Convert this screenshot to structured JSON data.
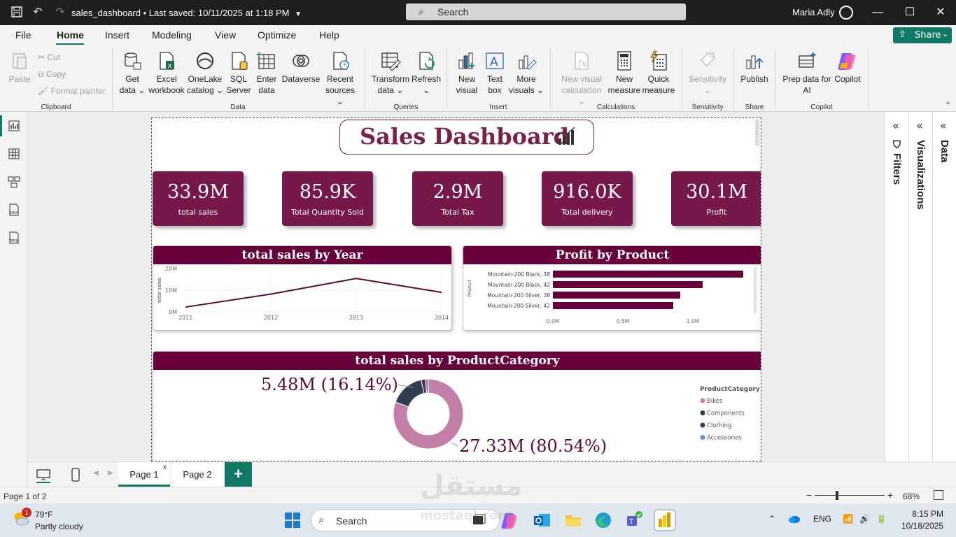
{
  "window": {
    "doc_title": "sales_dashboard • Last saved: 10/11/2025 at 1:18 PM",
    "search_label": "Search",
    "user_name": "Maria Adly"
  },
  "menu": {
    "items": [
      "File",
      "Home",
      "Insert",
      "Modeling",
      "View",
      "Optimize",
      "Help"
    ],
    "active": "Home",
    "share_label": "Share"
  },
  "ribbon": {
    "clipboard": {
      "paste": "Paste",
      "cut": "Cut",
      "copy": "Copy",
      "format_painter": "Format painter",
      "group": "Clipboard"
    },
    "data": {
      "get_data": [
        "Get",
        "data ⌄"
      ],
      "excel": [
        "Excel",
        "workbook"
      ],
      "onelake": [
        "OneLake",
        "catalog ⌄"
      ],
      "sql": [
        "SQL",
        "Server"
      ],
      "enter": [
        "Enter",
        "data"
      ],
      "dataverse": [
        "Dataverse",
        ""
      ],
      "recent": [
        "Recent",
        "sources ⌄"
      ],
      "group": "Data"
    },
    "queries": {
      "transform": [
        "Transform",
        "data ⌄"
      ],
      "refresh": [
        "Refresh",
        "⌄"
      ],
      "group": "Queries"
    },
    "insert": {
      "new_visual": [
        "New",
        "visual"
      ],
      "text_box": [
        "Text",
        "box"
      ],
      "more_visuals": [
        "More",
        "visuals ⌄"
      ],
      "group": "Insert"
    },
    "calculations": {
      "new_visual_calc": [
        "New visual",
        "calculation ⌄"
      ],
      "new_measure": [
        "New",
        "measure"
      ],
      "quick_measure": [
        "Quick",
        "measure"
      ],
      "group": "Calculations"
    },
    "sensitivity": {
      "label": [
        "Sensitivity",
        "⌄"
      ],
      "group": "Sensitivity"
    },
    "share": {
      "publish": [
        "Publish",
        ""
      ],
      "group": "Share"
    },
    "copilot": {
      "prep": [
        "Prep data for",
        "AI"
      ],
      "copilot": [
        "Copilot",
        ""
      ],
      "group": "Copilot"
    }
  },
  "report": {
    "title": "Sales Dashboard",
    "kpis": [
      {
        "value": "33.9M",
        "label": "total sales"
      },
      {
        "value": "85.9K",
        "label": "Total Quantity Sold"
      },
      {
        "value": "2.9M",
        "label": "Total Tax"
      },
      {
        "value": "916.0K",
        "label": "Total delivery"
      },
      {
        "value": "30.1M",
        "label": "Profit"
      }
    ],
    "colors": {
      "primary": "#76184a",
      "header": "#68003a",
      "line": "#5c0a33"
    }
  },
  "chart_data": [
    {
      "type": "line",
      "title": "total sales by Year",
      "xlabel": "",
      "ylabel": "total sales",
      "x": [
        "2011",
        "2012",
        "2013",
        "2014"
      ],
      "series": [
        {
          "values": [
            2.2,
            8.2,
            15.4,
            9.0
          ]
        }
      ],
      "yticks": [
        "0M",
        "10M",
        "20M"
      ],
      "ylim": [
        0,
        20
      ]
    },
    {
      "type": "bar",
      "orientation": "horizontal",
      "title": "Profit by Product",
      "ylabel": "Product",
      "categories": [
        "Mountain-200 Black, 38",
        "Mountain-200 Black, 42",
        "Mountain-200 Silver, 38",
        "Mountain-200 Silver, 42"
      ],
      "values": [
        1.36,
        1.07,
        0.91,
        0.86
      ],
      "xticks": [
        "0.0M",
        "0.5M",
        "1.0M"
      ],
      "xlim": [
        0,
        1.0
      ]
    },
    {
      "type": "pie",
      "variant": "donut",
      "title": "total sales by ProductCategory",
      "legend_title": "ProductCategory",
      "legend_position": "right",
      "categories": [
        "Bikes",
        "Components",
        "Clothing",
        "Accessories"
      ],
      "values": [
        80.54,
        16.14,
        2.0,
        1.32
      ],
      "colors": [
        "#c47fa8",
        "#2f3e4e",
        "#5a2a55",
        "#6b8fae"
      ],
      "data_labels": [
        {
          "text": "27.33M (80.54%)"
        },
        {
          "text": "5.48M (16.14%)"
        }
      ]
    }
  ],
  "panes": {
    "filters": "Filters",
    "visualizations": "Visualizations",
    "data": "Data"
  },
  "pages": {
    "tabs": [
      "Page 1",
      "Page 2"
    ],
    "close": "x",
    "add": "+"
  },
  "status": {
    "page_indicator": "Page 1 of 2",
    "zoom": "68%"
  },
  "taskbar": {
    "temperature": "79°F",
    "weather": "Partly cloudy",
    "weather_badge": "1",
    "search": "Search",
    "language": "ENG",
    "time": "8:15 PM",
    "date": "10/18/2025"
  },
  "watermark": {
    "arabic": "مستقل",
    "latin": "mostaql.com"
  }
}
